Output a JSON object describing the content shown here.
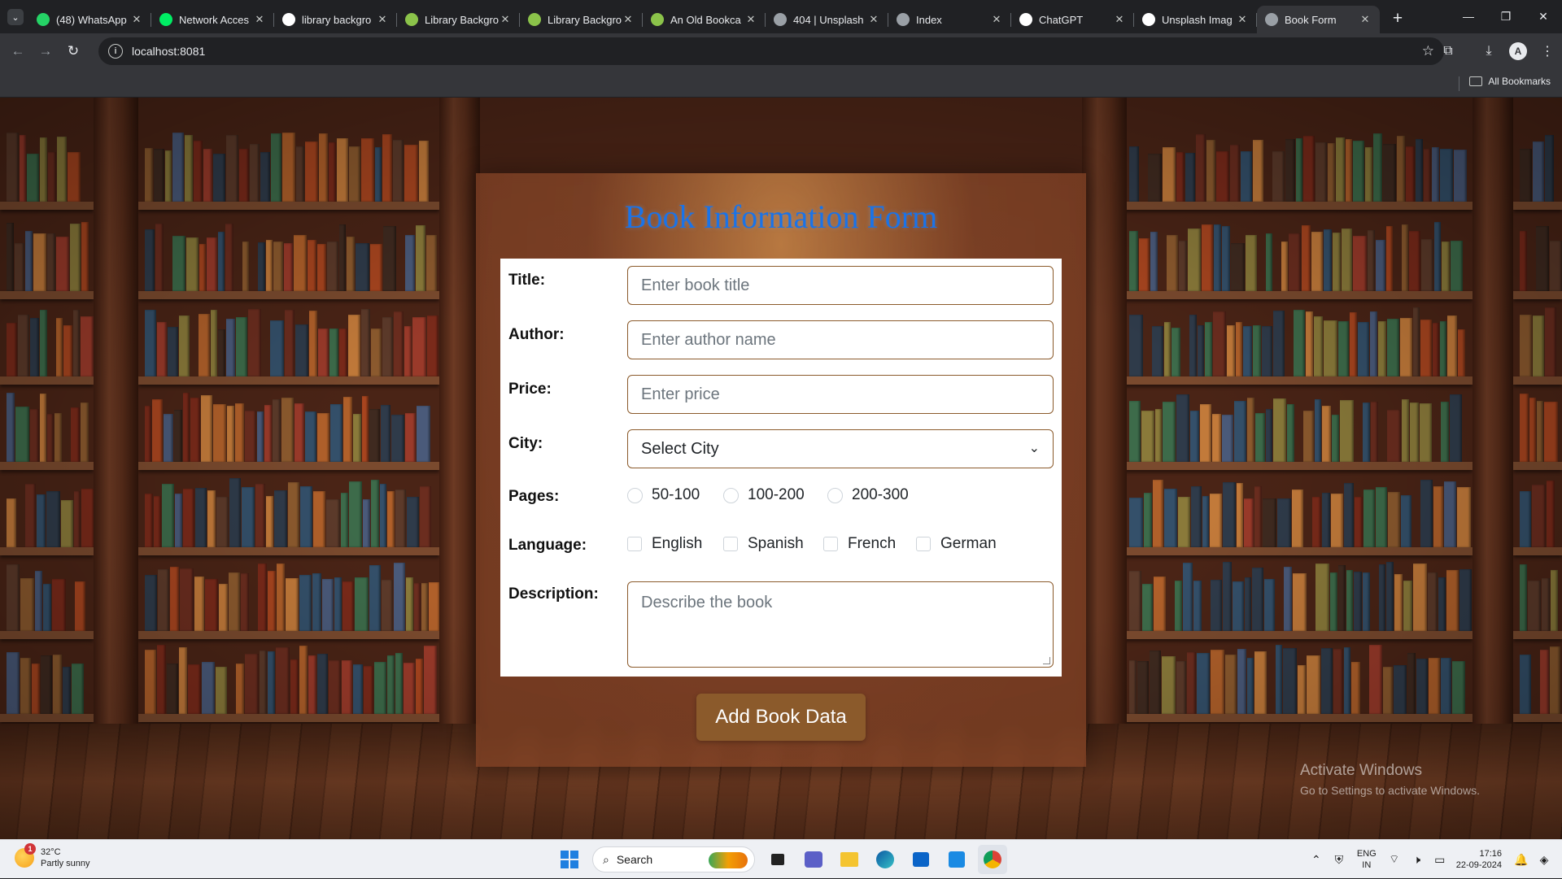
{
  "browser": {
    "tabs": [
      {
        "title": "(48) WhatsApp",
        "icon": "whatsapp-icon",
        "color": "#25d366"
      },
      {
        "title": "Network Acces",
        "icon": "leaf-icon",
        "color": "#00ed64"
      },
      {
        "title": "library backgro",
        "icon": "google-icon",
        "color": "#ffffff"
      },
      {
        "title": "Library Backgro",
        "icon": "library-site-icon",
        "color": "#8bc34a"
      },
      {
        "title": "Library Backgro",
        "icon": "library-site-icon",
        "color": "#8bc34a"
      },
      {
        "title": "An Old Bookca",
        "icon": "library-site-icon",
        "color": "#8bc34a"
      },
      {
        "title": "404 | Unsplash",
        "icon": "globe-icon",
        "color": "#9aa0a6"
      },
      {
        "title": "Index",
        "icon": "globe-icon",
        "color": "#9aa0a6"
      },
      {
        "title": "ChatGPT",
        "icon": "chatgpt-icon",
        "color": "#ffffff"
      },
      {
        "title": "Unsplash Imag",
        "icon": "unsplash-icon",
        "color": "#ffffff"
      },
      {
        "title": "Book Form",
        "icon": "globe-icon",
        "color": "#9aa0a6",
        "active": true
      }
    ],
    "url": "localhost:8081",
    "bookmarks_label": "All Bookmarks"
  },
  "form": {
    "heading": "Book Information Form",
    "title_label": "Title:",
    "title_placeholder": "Enter book title",
    "author_label": "Author:",
    "author_placeholder": "Enter author name",
    "price_label": "Price:",
    "price_placeholder": "Enter price",
    "city_label": "City:",
    "city_selected": "Select City",
    "pages_label": "Pages:",
    "pages_options": [
      "50-100",
      "100-200",
      "200-300"
    ],
    "language_label": "Language:",
    "language_options": [
      "English",
      "Spanish",
      "French",
      "German"
    ],
    "description_label": "Description:",
    "description_placeholder": "Describe the book",
    "submit_label": "Add Book Data",
    "accent_color": "#8b5a2b",
    "heading_color": "#1a73e8"
  },
  "watermark": {
    "line1": "Activate Windows",
    "line2": "Go to Settings to activate Windows."
  },
  "taskbar": {
    "weather_temp": "32°C",
    "weather_desc": "Partly sunny",
    "weather_badge": "1",
    "search_label": "Search",
    "lang_line1": "ENG",
    "lang_line2": "IN",
    "time": "17:16",
    "date": "22-09-2024"
  }
}
